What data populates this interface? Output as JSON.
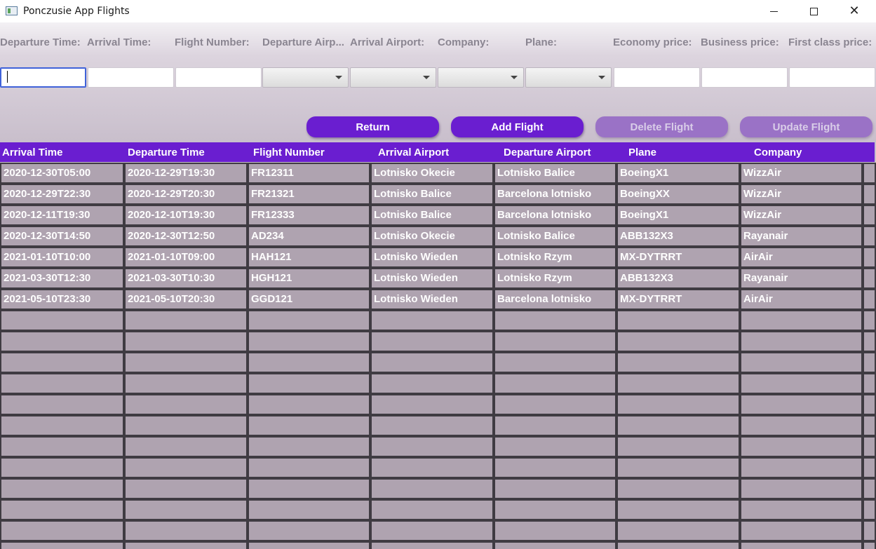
{
  "window": {
    "title": "Ponczusie App Flights",
    "minimize_icon": "minimize-icon",
    "maximize_icon": "maximize-icon",
    "close_icon": "close-icon"
  },
  "form": {
    "labels": [
      "Departure Time:",
      "Arrival Time:",
      "Flight Number:",
      "Departure Airp...",
      "Arrival Airport:",
      "Company:",
      "Plane:",
      "Economy price:",
      "Business price:",
      "First class price:"
    ],
    "departure_time": "",
    "arrival_time": "",
    "flight_number": "",
    "departure_airport": "",
    "arrival_airport": "",
    "company": "",
    "plane": "",
    "economy_price": "",
    "business_price": "",
    "first_class_price": ""
  },
  "buttons": {
    "return": "Return",
    "add": "Add Flight",
    "delete": "Delete Flight",
    "update": "Update Flight"
  },
  "table": {
    "columns": [
      "Arrival Time",
      "Departure Time",
      "Flight Number",
      "Arrival Airport",
      "Departure Airport",
      "Plane",
      "Company"
    ],
    "rows": [
      [
        "2020-12-30T05:00",
        "2020-12-29T19:30",
        "FR12311",
        "Lotnisko Okecie",
        "Lotnisko Balice",
        "BoeingX1",
        "WizzAir"
      ],
      [
        "2020-12-29T22:30",
        "2020-12-29T20:30",
        "FR21321",
        "Lotnisko Balice",
        "Barcelona lotnisko",
        "BoeingXX",
        "WizzAir"
      ],
      [
        "2020-12-11T19:30",
        "2020-12-10T19:30",
        "FR12333",
        "Lotnisko Balice",
        "Barcelona lotnisko",
        "BoeingX1",
        "WizzAir"
      ],
      [
        "2020-12-30T14:50",
        "2020-12-30T12:50",
        "AD234",
        "Lotnisko Okecie",
        "Lotnisko Balice",
        "ABB132X3",
        "Rayanair"
      ],
      [
        "2021-01-10T10:00",
        "2021-01-10T09:00",
        "HAH121",
        "Lotnisko Wieden",
        "Lotnisko Rzym",
        "MX-DYTRRT",
        "AirAir"
      ],
      [
        "2021-03-30T12:30",
        "2021-03-30T10:30",
        "HGH121",
        "Lotnisko Wieden",
        "Lotnisko Rzym",
        "ABB132X3",
        "Rayanair"
      ],
      [
        "2021-05-10T23:30",
        "2021-05-10T20:30",
        "GGD121",
        "Lotnisko Wieden",
        "Barcelona lotnisko",
        "MX-DYTRRT",
        "AirAir"
      ]
    ]
  },
  "colors": {
    "accent": "#6a1ed0",
    "disabled_button": "#9a72c6",
    "cell_background": "#afa3b0"
  }
}
